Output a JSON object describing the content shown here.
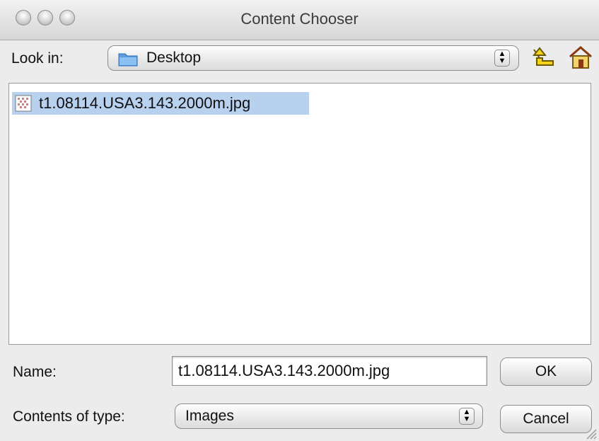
{
  "window": {
    "title": "Content Chooser"
  },
  "look_in": {
    "label": "Look in:",
    "value": "Desktop",
    "folder_icon": "blue-folder-icon"
  },
  "toolbar": {
    "up_icon": "up-one-level-icon",
    "home_icon": "home-icon"
  },
  "file_list": {
    "items": [
      {
        "name": "t1.08114.USA3.143.2000m.jpg",
        "icon": "image-file-icon",
        "selected": true
      }
    ]
  },
  "name_field": {
    "label": "Name:",
    "value": "t1.08114.USA3.143.2000m.jpg"
  },
  "type_field": {
    "label": "Contents of type:",
    "value": "Images"
  },
  "buttons": {
    "ok": "OK",
    "cancel": "Cancel"
  },
  "colors": {
    "selection": "#b8d1ef",
    "folder": "#5b9be0",
    "up_arrow": "#f3d21b"
  }
}
